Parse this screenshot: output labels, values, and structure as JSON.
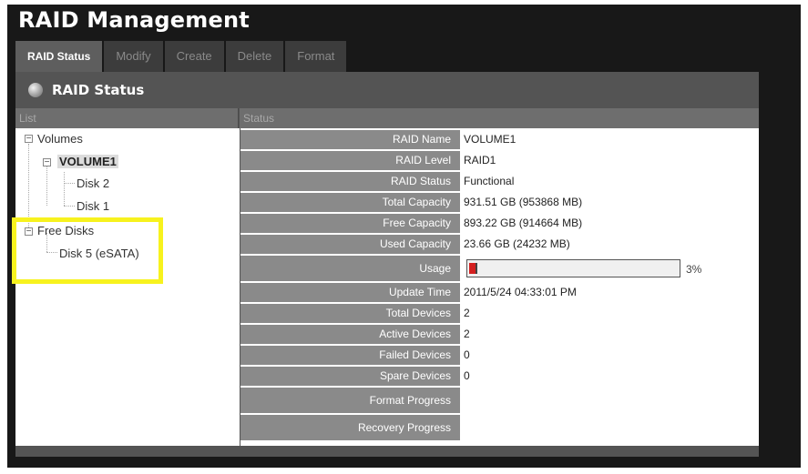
{
  "app": {
    "title": "RAID Management"
  },
  "tabs": [
    {
      "label": "RAID Status",
      "active": true
    },
    {
      "label": "Modify",
      "active": false
    },
    {
      "label": "Create",
      "active": false
    },
    {
      "label": "Delete",
      "active": false
    },
    {
      "label": "Format",
      "active": false
    }
  ],
  "section": {
    "title": "RAID Status",
    "icon": "status-orb-icon"
  },
  "columns": {
    "list": "List",
    "status": "Status"
  },
  "tree": {
    "volumes": "Volumes",
    "volume1": "VOLUME1",
    "disk2": "Disk 2",
    "disk1": "Disk 1",
    "free_disks": "Free Disks",
    "disk5": "Disk 5 (eSATA)",
    "collapse_glyph": "−"
  },
  "status": {
    "rows": [
      {
        "label": "RAID Name",
        "value": "VOLUME1"
      },
      {
        "label": "RAID Level",
        "value": "RAID1"
      },
      {
        "label": "RAID Status",
        "value": "Functional"
      },
      {
        "label": "Total Capacity",
        "value": "931.51 GB (953868 MB)"
      },
      {
        "label": "Free Capacity",
        "value": "893.22 GB (914664 MB)"
      },
      {
        "label": "Used Capacity",
        "value": "23.66 GB (24232 MB)"
      },
      {
        "label": "Usage",
        "value": "",
        "percent": 3
      },
      {
        "label": "Update Time",
        "value": "2011/5/24  04:33:01 PM"
      },
      {
        "label": "Total Devices",
        "value": "2"
      },
      {
        "label": "Active Devices",
        "value": "2"
      },
      {
        "label": "Failed Devices",
        "value": "0"
      },
      {
        "label": "Spare Devices",
        "value": "0"
      },
      {
        "label": "Format Progress",
        "value": ""
      },
      {
        "label": "Recovery Progress",
        "value": ""
      }
    ],
    "usage_text": "3%"
  },
  "colors": {
    "highlight": "#f7f21e",
    "usage_fill": "#d42020",
    "label_bg": "#8a8a8a",
    "frame_bg": "#181818"
  }
}
